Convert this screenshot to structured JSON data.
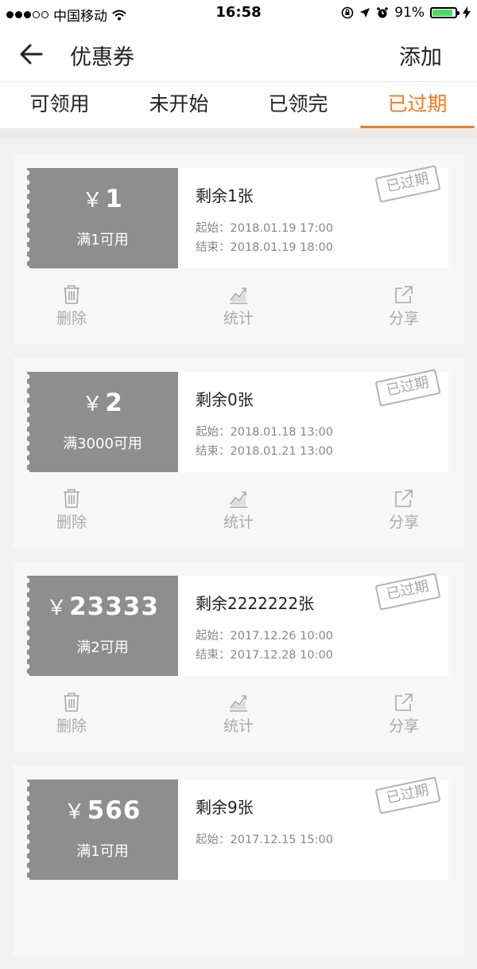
{
  "status_bar": {
    "carrier": "中国移动",
    "time": "16:58",
    "battery_pct": "91%",
    "battery_level": 0.91
  },
  "nav": {
    "title": "优惠券",
    "add_label": "添加"
  },
  "tabs": [
    {
      "label": "可领用"
    },
    {
      "label": "未开始"
    },
    {
      "label": "已领完"
    },
    {
      "label": "已过期"
    }
  ],
  "active_tab": 3,
  "colors": {
    "accent": "#ff7a1a",
    "stub": "#8e8e8e"
  },
  "coupons": [
    {
      "amount": "1",
      "condition": "满1可用",
      "remaining": "剩余1张",
      "start": "起始：2018.01.19 17:00",
      "end": "结束：2018.01.19 18:00",
      "stamp": "已过期"
    },
    {
      "amount": "2",
      "condition": "满3000可用",
      "remaining": "剩余0张",
      "start": "起始：2018.01.18 13:00",
      "end": "结束：2018.01.21 13:00",
      "stamp": "已过期"
    },
    {
      "amount": "23333",
      "condition": "满2可用",
      "remaining": "剩余2222222张",
      "start": "起始：2017.12.26 10:00",
      "end": "结束：2017.12.28 10:00",
      "stamp": "已过期"
    },
    {
      "amount": "566",
      "condition": "满1可用",
      "remaining": "剩余9张",
      "start": "起始：2017.12.15 15:00",
      "end": "",
      "stamp": "已过期"
    }
  ],
  "currency_symbol": "￥",
  "actions": {
    "delete": "删除",
    "stats": "统计",
    "share": "分享"
  },
  "icons": {
    "back": "arrow-left-icon",
    "delete": "trash-icon",
    "stats": "chart-icon",
    "share": "share-icon"
  }
}
